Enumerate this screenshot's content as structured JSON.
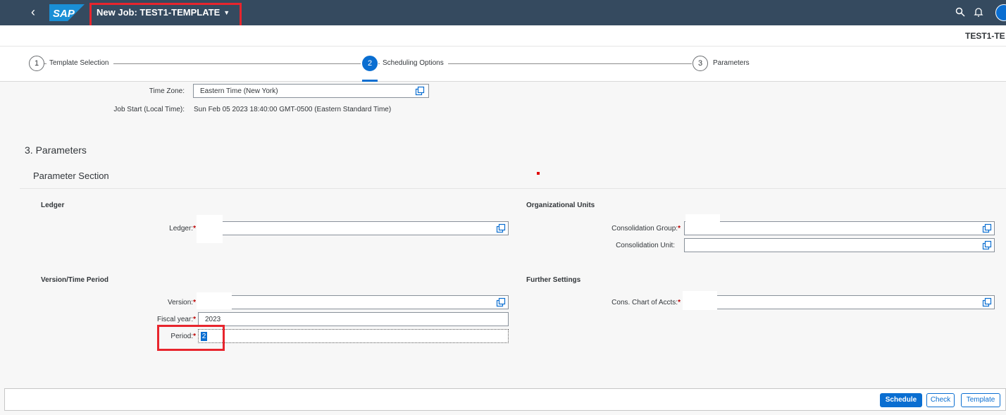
{
  "shell": {
    "back_glyph": "‹",
    "logo_text": "SAP",
    "title": "New Job: TEST1-TEMPLATE",
    "title_caret": "▼",
    "icons": [
      "search-icon",
      "bell-icon",
      "avatar"
    ]
  },
  "subheader": {
    "title": "TEST1-TE"
  },
  "wizard": {
    "steps": [
      {
        "number": "1",
        "label": "Template Selection",
        "active": false
      },
      {
        "number": "2",
        "label": "Scheduling Options",
        "active": true
      },
      {
        "number": "3",
        "label": "Parameters",
        "active": false
      }
    ]
  },
  "scheduling": {
    "time_zone_label": "Time Zone:",
    "time_zone_value": "Eastern Time (New York)",
    "job_start_label": "Job Start (Local Time):",
    "job_start_value": "Sun Feb 05 2023 18:40:00 GMT-0500 (Eastern Standard Time)"
  },
  "parameters": {
    "heading": "3. Parameters",
    "section_title": "Parameter Section",
    "ledger_group": {
      "title": "Ledger",
      "ledger_label": "Ledger:",
      "ledger_value": ""
    },
    "version_group": {
      "title": "Version/Time Period",
      "version_label": "Version:",
      "version_value": "",
      "fiscal_year_label": "Fiscal year:",
      "fiscal_year_value": "2023",
      "period_label": "Period:",
      "period_value": "2"
    },
    "org_group": {
      "title": "Organizational Units",
      "cons_group_label": "Consolidation Group:",
      "cons_group_value": "",
      "cons_unit_label": "Consolidation Unit:",
      "cons_unit_value": ""
    },
    "further_group": {
      "title": "Further Settings",
      "chart_label": "Cons. Chart of Accts:",
      "chart_value": ""
    },
    "required_marker": "*"
  },
  "footer": {
    "schedule_label": "Schedule",
    "check_label": "Check",
    "template_label": "Template"
  },
  "colors": {
    "shell_bg": "#354a5f",
    "brand_blue": "#0a6ed1",
    "required_red": "#bb0000",
    "highlight_red": "#e8252d"
  }
}
